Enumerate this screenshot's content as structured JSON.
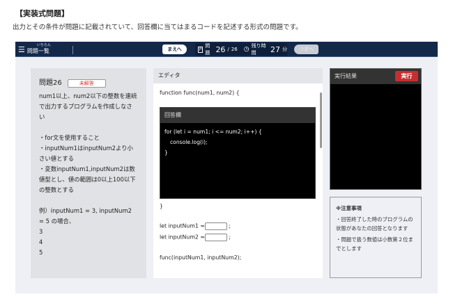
{
  "intro": {
    "title": "【実装式問題】",
    "description": "出力とその条件が問題に記載されていて、回答欄に当てはまるコードを記述する形式の問題です。"
  },
  "nav": {
    "menu_label": "問題一覧",
    "menu_ruby": "いちらん",
    "prev_label": "まえへ",
    "next_label": "つぎへ",
    "question_label": "問題",
    "question_current": "26",
    "question_total": "26",
    "time_label": "残り時間",
    "time_value": "27",
    "time_unit": "分"
  },
  "question": {
    "title": "問題26",
    "status_badge": "未解答",
    "body": "num1以上、num2以下の整数を連続で出力するプログラムを作成しなさい",
    "conditions": [
      "・for文を使用すること",
      "・inputNum1はinputNum2より小さい値とする",
      "・変数inputNum1,inputNum2は数値型とし、値の範囲は0以上100以下の整数とする"
    ],
    "example": "例）inputNum1 = 3, inputNum2 = 5 の場合、",
    "outputs": [
      "3",
      "4",
      "5"
    ]
  },
  "editor": {
    "title": "エディタ",
    "line_function": "function func(num1, num2) {",
    "answer_title": "回答欄",
    "answer_lines": [
      "for (let i = num1; i <= num2; i++) {",
      "console.log(i);",
      "}"
    ],
    "line_close": "}",
    "input1_label": "let inputNum1 =",
    "input2_label": "let inputNum2 =",
    "semicolon": ";",
    "input1_value": "",
    "input2_value": "",
    "line_call": "func(inputNum1, inputNum2);"
  },
  "result": {
    "title": "実行結果",
    "run_label": "実行"
  },
  "notes": {
    "title": "※注意事項",
    "items": [
      "・回答終了した時のプログラムの状態があなたの回答となります",
      "・問題で扱う数値は小数第２位までとします"
    ]
  }
}
